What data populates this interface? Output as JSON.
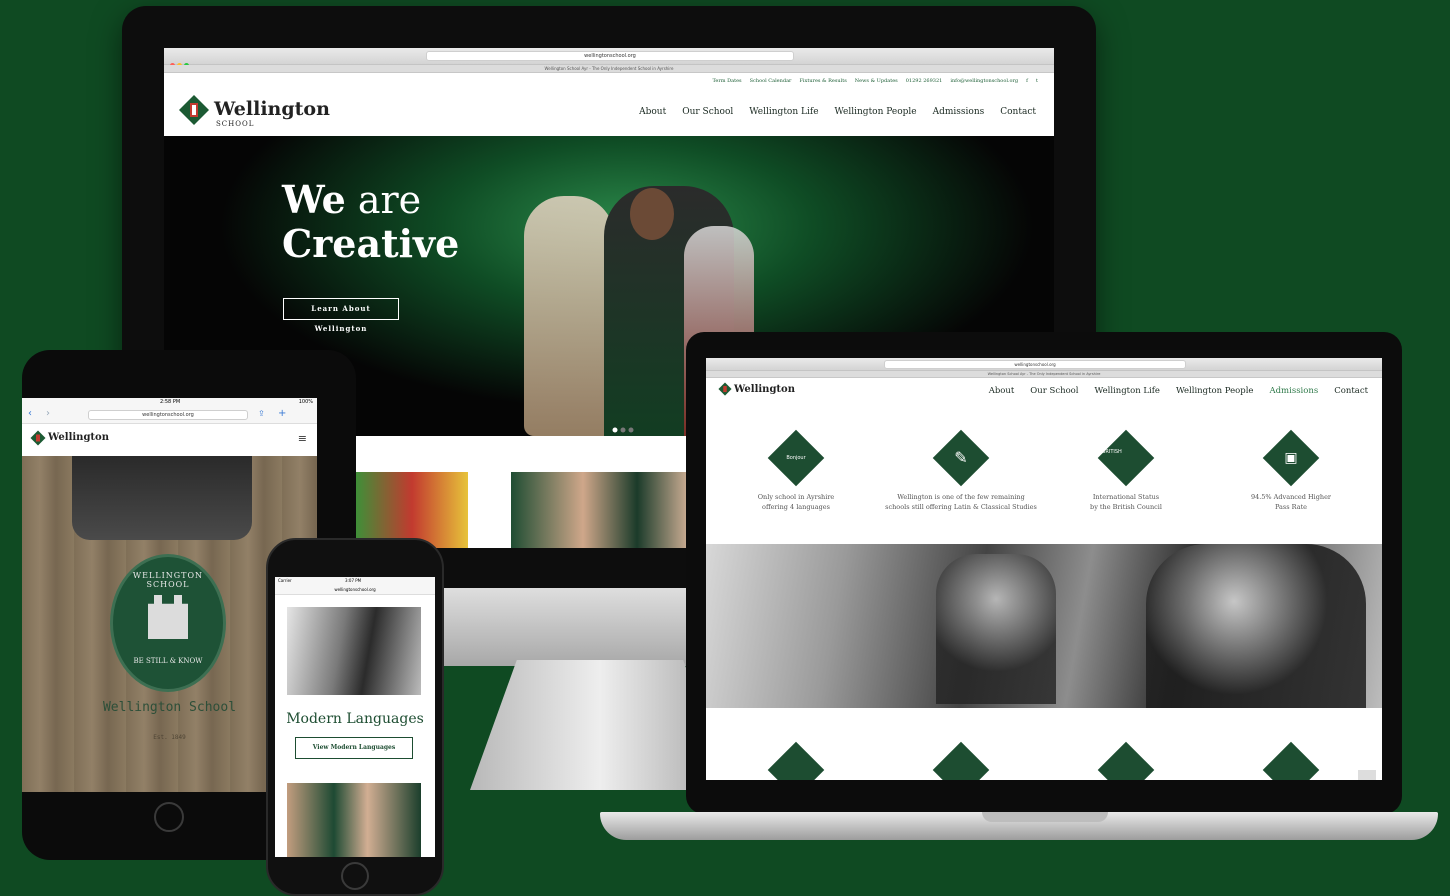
{
  "site": {
    "url": "wellingtonschool.org",
    "tab_title": "Wellington School Ayr - The Only Independent School in Ayrshire",
    "logo_name": "Wellington",
    "logo_sub": "SCHOOL"
  },
  "imac": {
    "topbar": [
      "Term Dates",
      "School Calendar",
      "Fixtures & Results",
      "News & Updates",
      "01292 269321",
      "info@wellingtonschool.org"
    ],
    "nav": [
      "About",
      "Our School",
      "Wellington Life",
      "Wellington People",
      "Admissions",
      "Contact"
    ],
    "hero": {
      "line1_bold": "We",
      "line1_light": "are",
      "line2": "Creative",
      "button": "Learn About Wellington"
    }
  },
  "ipad": {
    "time": "2:58 PM",
    "battery": "100%",
    "url": "wellingtonschool.org",
    "school_name": "Wellington School",
    "est": "Est. 1849",
    "crest_top": "WELLINGTON SCHOOL",
    "crest_bottom": "BE STILL & KNOW"
  },
  "iphone": {
    "carrier": "Carrier",
    "time": "3:07 PM",
    "url": "wellingtonschool.org",
    "section_title": "Modern Languages",
    "button": "View Modern Languages"
  },
  "macbook": {
    "nav": [
      "About",
      "Our School",
      "Wellington Life",
      "Wellington People",
      "Admissions",
      "Contact"
    ],
    "features": [
      {
        "line1": "Only school in Ayrshire",
        "line2": "offering 4 languages",
        "icon": "speech-bubble-icon"
      },
      {
        "line1": "Wellington is one of the few remaining",
        "line2": "schools still offering Latin & Classical Studies",
        "icon": "quill-icon"
      },
      {
        "line1": "International Status",
        "line2": "by the British Council",
        "icon": "british-council-icon"
      },
      {
        "line1": "94.5% Advanced Higher",
        "line2": "Pass Rate",
        "icon": "certificate-icon"
      }
    ],
    "badge_text": "Bonjour",
    "bc_text": "BRITISH COUNCIL"
  },
  "colors": {
    "background": "#0f4a22",
    "brand_green": "#1d4d31",
    "admissions_active": "#2f7a4a"
  }
}
